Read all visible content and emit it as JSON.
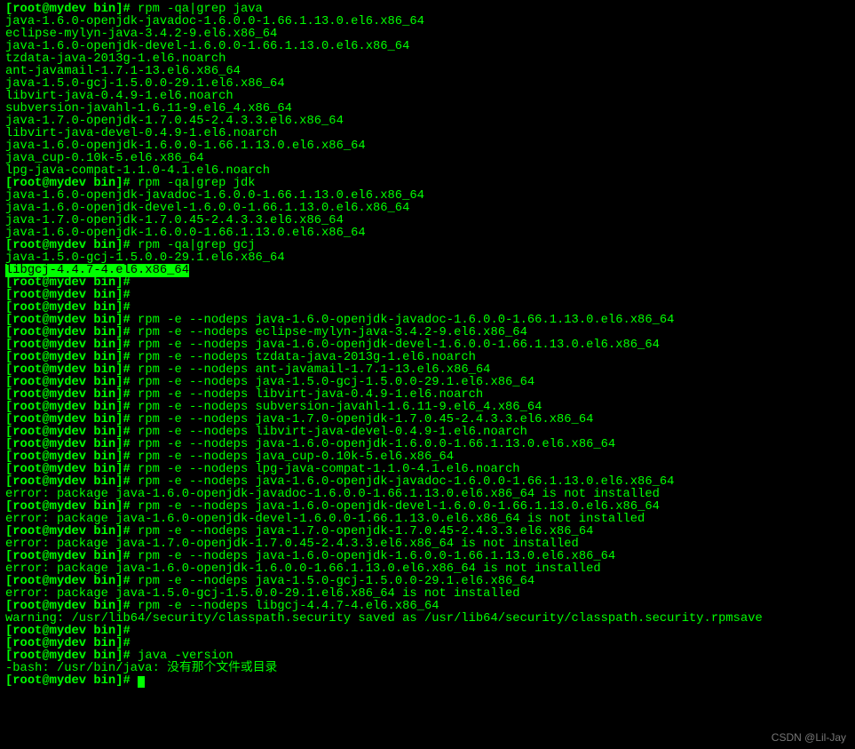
{
  "prompt": "[root@mydev bin]#",
  "cmds": {
    "c1": "rpm -qa|grep java",
    "c2": "rpm -qa|grep jdk",
    "c3": "rpm -qa|grep gcj",
    "c4": "java -version"
  },
  "out1": [
    "java-1.6.0-openjdk-javadoc-1.6.0.0-1.66.1.13.0.el6.x86_64",
    "eclipse-mylyn-java-3.4.2-9.el6.x86_64",
    "java-1.6.0-openjdk-devel-1.6.0.0-1.66.1.13.0.el6.x86_64",
    "tzdata-java-2013g-1.el6.noarch",
    "ant-javamail-1.7.1-13.el6.x86_64",
    "java-1.5.0-gcj-1.5.0.0-29.1.el6.x86_64",
    "libvirt-java-0.4.9-1.el6.noarch",
    "subversion-javahl-1.6.11-9.el6_4.x86_64",
    "java-1.7.0-openjdk-1.7.0.45-2.4.3.3.el6.x86_64",
    "libvirt-java-devel-0.4.9-1.el6.noarch",
    "java-1.6.0-openjdk-1.6.0.0-1.66.1.13.0.el6.x86_64",
    "java_cup-0.10k-5.el6.x86_64",
    "lpg-java-compat-1.1.0-4.1.el6.noarch"
  ],
  "out2": [
    "java-1.6.0-openjdk-javadoc-1.6.0.0-1.66.1.13.0.el6.x86_64",
    "java-1.6.0-openjdk-devel-1.6.0.0-1.66.1.13.0.el6.x86_64",
    "java-1.7.0-openjdk-1.7.0.45-2.4.3.3.el6.x86_64",
    "java-1.6.0-openjdk-1.6.0.0-1.66.1.13.0.el6.x86_64"
  ],
  "out3": [
    "java-1.5.0-gcj-1.5.0.0-29.1.el6.x86_64"
  ],
  "highlight": "libgcj-4.4.7-4.el6.x86_64",
  "rpm_e": [
    "rpm -e --nodeps java-1.6.0-openjdk-javadoc-1.6.0.0-1.66.1.13.0.el6.x86_64",
    "rpm -e --nodeps eclipse-mylyn-java-3.4.2-9.el6.x86_64",
    "rpm -e --nodeps java-1.6.0-openjdk-devel-1.6.0.0-1.66.1.13.0.el6.x86_64",
    "rpm -e --nodeps tzdata-java-2013g-1.el6.noarch",
    "rpm -e --nodeps ant-javamail-1.7.1-13.el6.x86_64",
    "rpm -e --nodeps java-1.5.0-gcj-1.5.0.0-29.1.el6.x86_64",
    "rpm -e --nodeps libvirt-java-0.4.9-1.el6.noarch",
    "rpm -e --nodeps subversion-javahl-1.6.11-9.el6_4.x86_64",
    "rpm -e --nodeps java-1.7.0-openjdk-1.7.0.45-2.4.3.3.el6.x86_64",
    "rpm -e --nodeps libvirt-java-devel-0.4.9-1.el6.noarch",
    "rpm -e --nodeps java-1.6.0-openjdk-1.6.0.0-1.66.1.13.0.el6.x86_64",
    "rpm -e --nodeps java_cup-0.10k-5.el6.x86_64",
    "rpm -e --nodeps lpg-java-compat-1.1.0-4.1.el6.noarch"
  ],
  "errblock": [
    {
      "cmd": "rpm -e --nodeps java-1.6.0-openjdk-javadoc-1.6.0.0-1.66.1.13.0.el6.x86_64",
      "err": "error: package java-1.6.0-openjdk-javadoc-1.6.0.0-1.66.1.13.0.el6.x86_64 is not installed"
    },
    {
      "cmd": "rpm -e --nodeps java-1.6.0-openjdk-devel-1.6.0.0-1.66.1.13.0.el6.x86_64",
      "err": "error: package java-1.6.0-openjdk-devel-1.6.0.0-1.66.1.13.0.el6.x86_64 is not installed"
    },
    {
      "cmd": "rpm -e --nodeps java-1.7.0-openjdk-1.7.0.45-2.4.3.3.el6.x86_64",
      "err": "error: package java-1.7.0-openjdk-1.7.0.45-2.4.3.3.el6.x86_64 is not installed"
    },
    {
      "cmd": "rpm -e --nodeps java-1.6.0-openjdk-1.6.0.0-1.66.1.13.0.el6.x86_64",
      "err": "error: package java-1.6.0-openjdk-1.6.0.0-1.66.1.13.0.el6.x86_64 is not installed"
    },
    {
      "cmd": "rpm -e --nodeps java-1.5.0-gcj-1.5.0.0-29.1.el6.x86_64",
      "err": "error: package java-1.5.0-gcj-1.5.0.0-29.1.el6.x86_64 is not installed"
    }
  ],
  "gcj_cmd": "rpm -e --nodeps libgcj-4.4.7-4.el6.x86_64",
  "warning": "warning: /usr/lib64/security/classpath.security saved as /usr/lib64/security/classpath.security.rpmsave",
  "bash_err": "-bash: /usr/bin/java: 没有那个文件或目录",
  "watermark": "CSDN @Lil-Jay"
}
